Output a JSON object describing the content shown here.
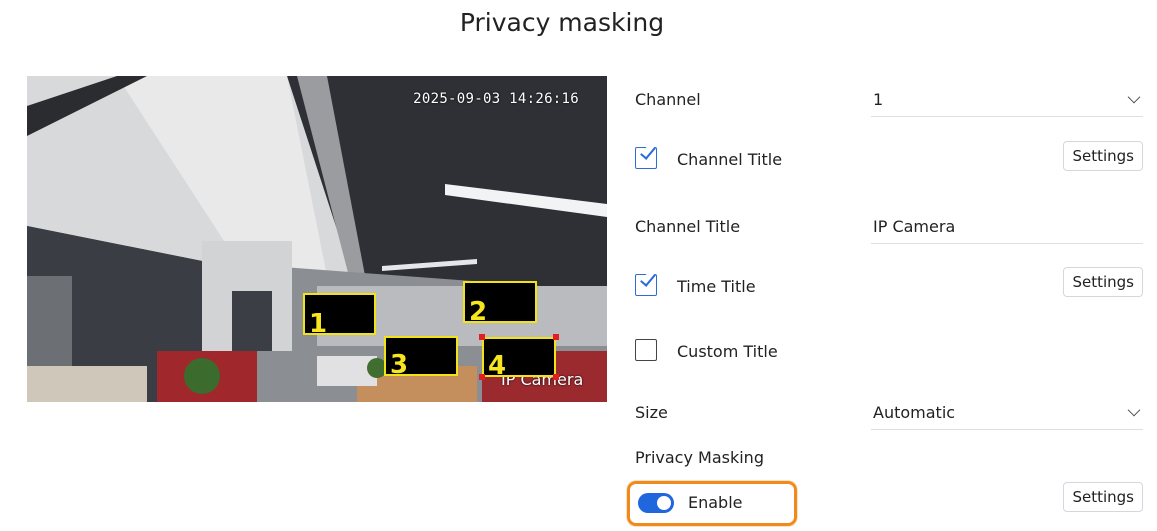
{
  "page": {
    "title": "Privacy masking"
  },
  "preview": {
    "timestamp": "2025-09-03 14:26:16",
    "osd_title": "IP Camera",
    "masks": [
      {
        "label": "1",
        "selected": false
      },
      {
        "label": "2",
        "selected": false
      },
      {
        "label": "3",
        "selected": false
      },
      {
        "label": "4",
        "selected": true
      }
    ],
    "colors": {
      "mask_border": "#f2e21a",
      "mask_fill": "#000000",
      "handle": "#e02020"
    }
  },
  "form": {
    "channel": {
      "label": "Channel",
      "value": "1"
    },
    "channel_title_checkbox": {
      "label": "Channel Title",
      "checked": true,
      "button": "Settings"
    },
    "channel_title_field": {
      "label": "Channel Title",
      "value": "IP Camera"
    },
    "time_title": {
      "label": "Time Title",
      "checked": true,
      "button": "Settings"
    },
    "custom_title": {
      "label": "Custom Title",
      "checked": false
    },
    "size": {
      "label": "Size",
      "value": "Automatic"
    },
    "privacy_masking": {
      "label": "Privacy Masking",
      "toggle_label": "Enable",
      "enabled": true,
      "button": "Settings"
    }
  },
  "colors": {
    "accent": "#2067de",
    "highlight": "#f08a1c"
  }
}
